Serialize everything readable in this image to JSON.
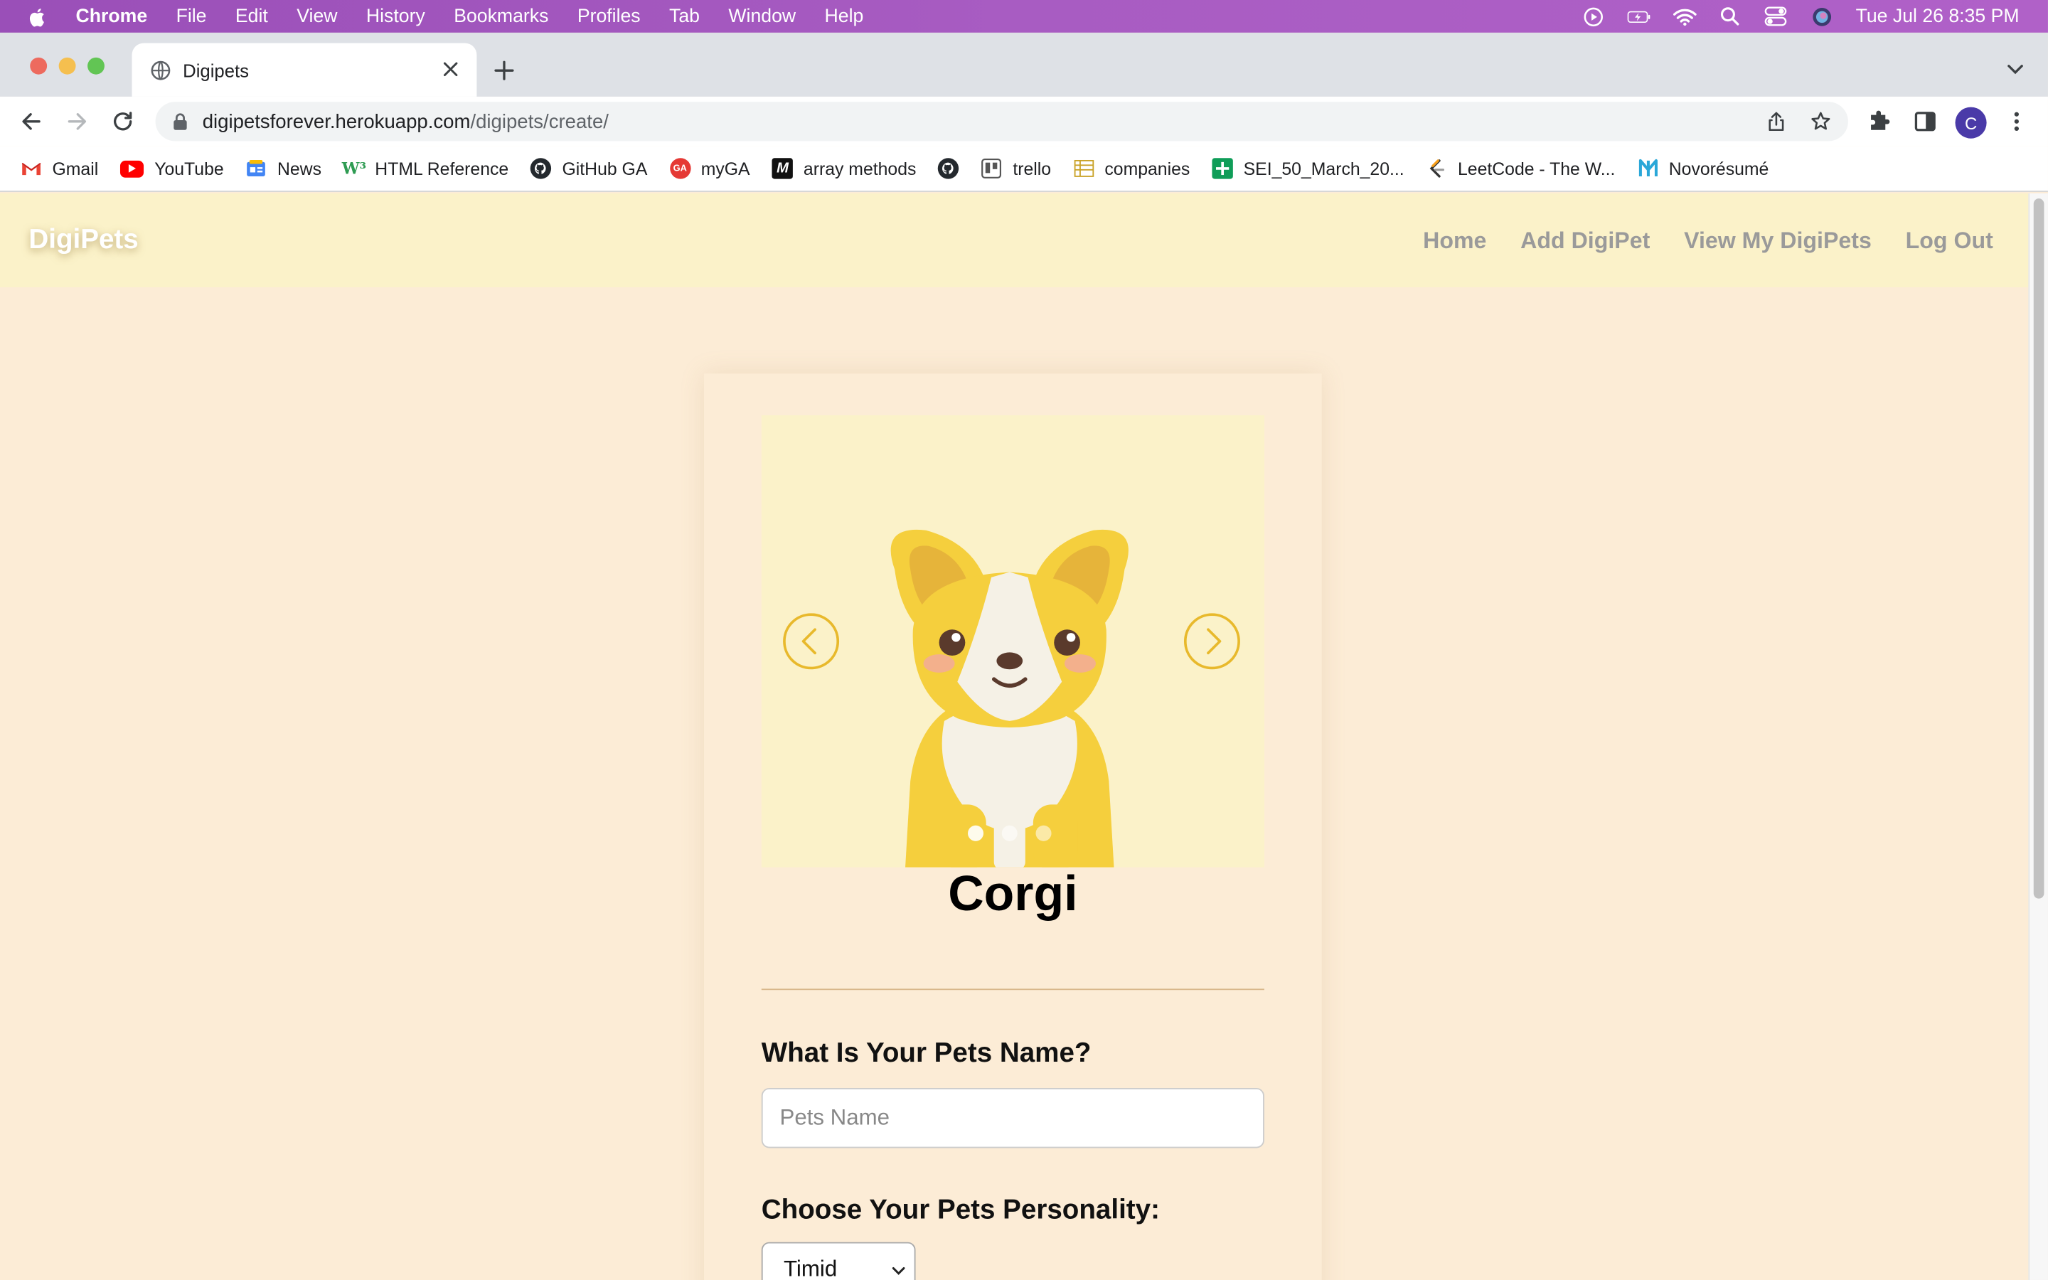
{
  "menubar": {
    "app": "Chrome",
    "items": [
      "File",
      "Edit",
      "View",
      "History",
      "Bookmarks",
      "Profiles",
      "Tab",
      "Window",
      "Help"
    ],
    "clock": "Tue Jul 26  8:35 PM"
  },
  "browser": {
    "tab_title": "Digipets",
    "url_host": "digipetsforever.herokuapp.com",
    "url_path": "/digipets/create/",
    "profile_initial": "C"
  },
  "bookmarks": [
    {
      "label": "Gmail",
      "icon": "gmail-icon",
      "color": "#ea4335"
    },
    {
      "label": "YouTube",
      "icon": "youtube-icon",
      "color": "#ff0000"
    },
    {
      "label": "News",
      "icon": "news-icon",
      "color": "#4285f4"
    },
    {
      "label": "HTML Reference",
      "icon": "w3-icon",
      "color": "#2e9b52"
    },
    {
      "label": "GitHub GA",
      "icon": "github-icon",
      "color": "#24292e"
    },
    {
      "label": "myGA",
      "icon": "ga-icon",
      "color": "#e53935"
    },
    {
      "label": "array methods",
      "icon": "m-icon",
      "color": "#111111"
    },
    {
      "label": "",
      "icon": "github-icon",
      "color": "#24292e"
    },
    {
      "label": "trello",
      "icon": "trello-icon",
      "color": "#555555"
    },
    {
      "label": "companies",
      "icon": "sheet-icon",
      "color": "#c9a227"
    },
    {
      "label": "SEI_50_March_20...",
      "icon": "sheets-icon",
      "color": "#0f9d58"
    },
    {
      "label": "LeetCode - The W...",
      "icon": "leetcode-icon",
      "color": "#f89f1b"
    },
    {
      "label": "Novorésumé",
      "icon": "novoresume-icon",
      "color": "#2aa7d8"
    }
  ],
  "site": {
    "brand": "DigiPets",
    "nav": [
      "Home",
      "Add DigiPet",
      "View My DigiPets",
      "Log Out"
    ]
  },
  "form": {
    "pet_type": "Corgi",
    "name_label": "What Is Your Pets Name?",
    "name_placeholder": "Pets Name",
    "personality_label": "Choose Your Pets Personality:",
    "personality_value": "Timid"
  },
  "colors": {
    "menubar": "#a85cc2",
    "nav_bg": "#fbf2c9",
    "page_bg": "#fcecd6",
    "accent": "#e8b92c"
  }
}
